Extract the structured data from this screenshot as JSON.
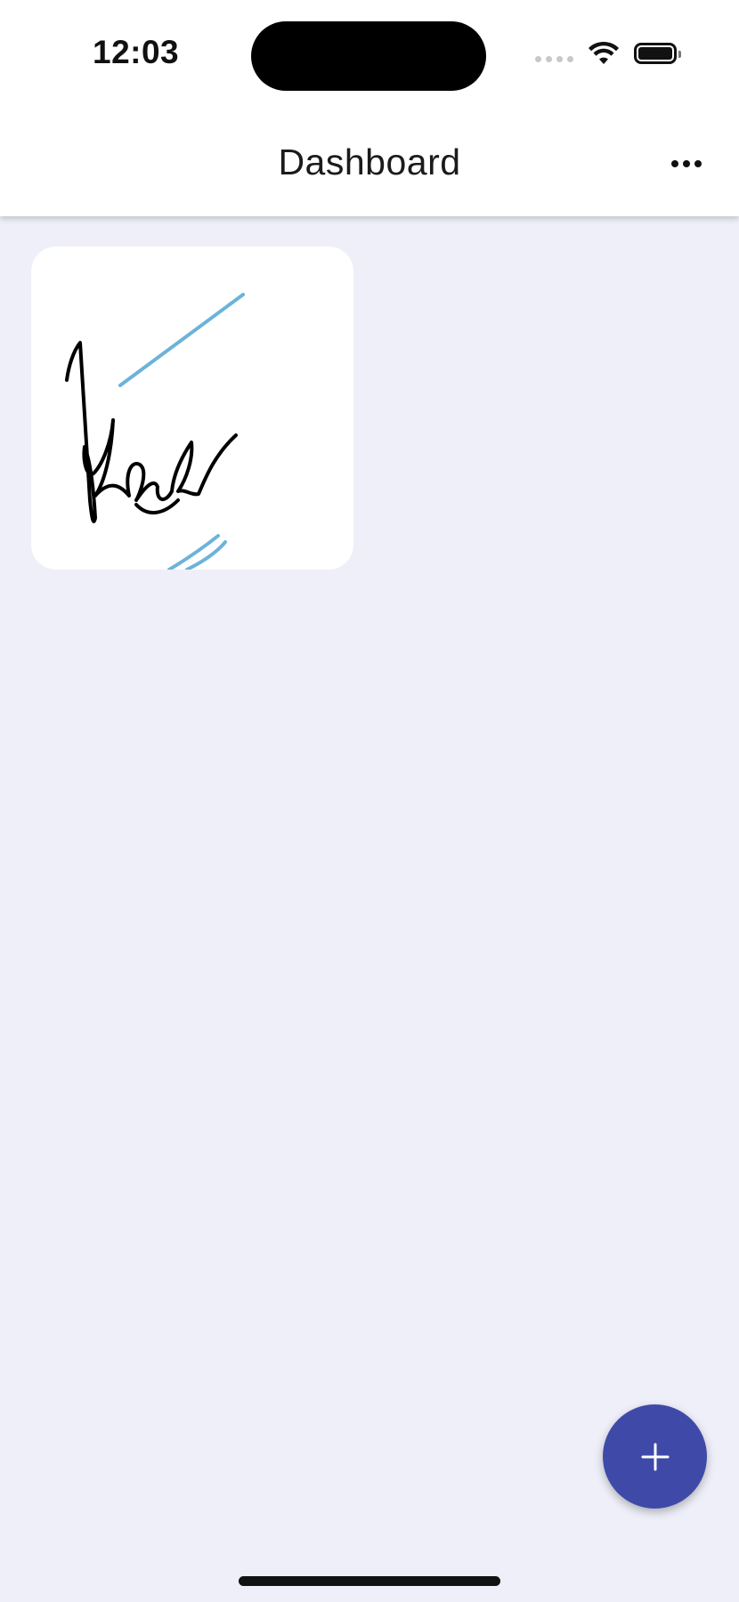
{
  "status_bar": {
    "time": "12:03",
    "icons": [
      "cellular-signal-icon",
      "wifi-icon",
      "battery-icon"
    ]
  },
  "app_bar": {
    "title": "Dashboard",
    "menu_icon": "more-horizontal-icon"
  },
  "cards": [
    {
      "type": "signature-thumbnail",
      "ink_colors": [
        "#000000",
        "#6cb3d9"
      ]
    }
  ],
  "fab": {
    "icon": "plus-icon"
  },
  "colors": {
    "background": "#eeeff8",
    "surface": "#ffffff",
    "accent": "#3f4aa8",
    "ink_blue": "#6cb3d9"
  }
}
